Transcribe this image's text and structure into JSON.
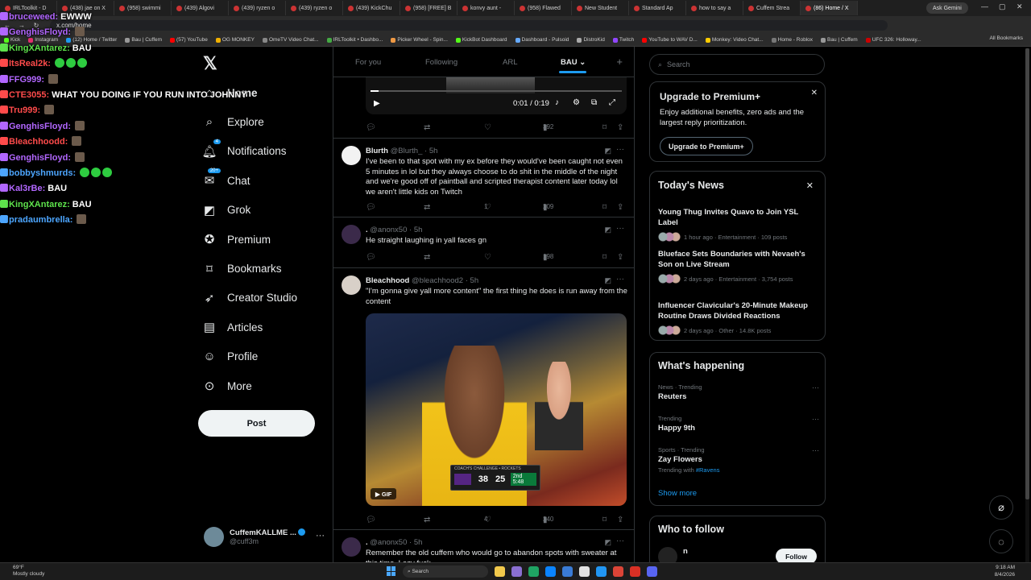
{
  "browser": {
    "tabs": [
      {
        "label": "IRLToolkit - D",
        "active": false
      },
      {
        "label": "(438) jae on X",
        "active": false
      },
      {
        "label": "(958) swimmi",
        "active": false
      },
      {
        "label": "(439) Algovi",
        "active": false
      },
      {
        "label": "(439) ryzen o",
        "active": false
      },
      {
        "label": "(439) ryzen o",
        "active": false
      },
      {
        "label": "(439) KickChu",
        "active": false
      },
      {
        "label": "(958) [FREE] B",
        "active": false
      },
      {
        "label": "konvy aunt -",
        "active": false
      },
      {
        "label": "(958) Flawed",
        "active": false
      },
      {
        "label": "New Student",
        "active": false
      },
      {
        "label": "Standard Ap",
        "active": false
      },
      {
        "label": "how to say a",
        "active": false
      },
      {
        "label": "Cuffem Strea",
        "active": false
      },
      {
        "label": "(86) Home / X",
        "active": true
      }
    ],
    "ask_gemini": "Ask Gemini",
    "url": "x.com/home",
    "bookmarks": [
      "Kick",
      "Instagram",
      "(12) Home / Twitter",
      "Bau | Cuffem",
      "(57) YouTube",
      "OG MONKEY",
      "OmeTV Video Chat...",
      "IRLToolkit • Dashbo...",
      "Picker Wheel - Spin...",
      "KickBot Dashboard",
      "Dashboard - Pulsoid",
      "DistroKid",
      "Twitch",
      "YouTube to WAV D...",
      "Monkey: Video Chat...",
      "Home - Roblox",
      "Bau | Cuffem",
      "UFC 326: Holloway..."
    ],
    "all_bookmarks": "All Bookmarks"
  },
  "chat": [
    {
      "user": "bruceweed:",
      "msg": "EWWW",
      "color": "#b267ff",
      "emotes": 0
    },
    {
      "user": "GenghisFloyd:",
      "msg": "",
      "color": "#b267ff",
      "emotes": 0
    },
    {
      "user": "KingXAntarez:",
      "msg": "BAU",
      "color": "#5ee34c",
      "emotes": 0
    },
    {
      "user": "ItsReal2k:",
      "msg": "",
      "color": "#ff4b4b",
      "emotes": 3
    },
    {
      "user": "FFG999:",
      "msg": "",
      "color": "#b267ff",
      "emotes": 0
    },
    {
      "user": "CTE3055:",
      "msg": "WHAT YOU DOING IF YOU RUN INTO JOHNNY",
      "color": "#ff4b4b",
      "emotes": 0
    },
    {
      "user": "Tru999:",
      "msg": "",
      "color": "#ff4b4b",
      "emotes": 0
    },
    {
      "user": "GenghisFloyd:",
      "msg": "",
      "color": "#b267ff",
      "emotes": 0
    },
    {
      "user": "Bleachhoodd:",
      "msg": "",
      "color": "#ff4b4b",
      "emotes": 0
    },
    {
      "user": "GenghisFloyd:",
      "msg": "",
      "color": "#b267ff",
      "emotes": 0
    },
    {
      "user": "bobbyshmurds:",
      "msg": "",
      "color": "#4da6ff",
      "emotes": 3
    },
    {
      "user": "Kal3rBe:",
      "msg": "BAU",
      "color": "#b267ff",
      "emotes": 0
    },
    {
      "user": "KingXAntarez:",
      "msg": "BAU",
      "color": "#5ee34c",
      "emotes": 0
    },
    {
      "user": "pradaumbrella:",
      "msg": "",
      "color": "#4da6ff",
      "emotes": 0
    }
  ],
  "nav": {
    "items": [
      {
        "label": "Home",
        "icon": "home-icon"
      },
      {
        "label": "Explore",
        "icon": "search-icon"
      },
      {
        "label": "Notifications",
        "icon": "bell-icon",
        "badge": "4"
      },
      {
        "label": "Chat",
        "icon": "chat-icon",
        "badge": "20+"
      },
      {
        "label": "Grok",
        "icon": "grok-icon"
      },
      {
        "label": "Premium",
        "icon": "premium-icon"
      },
      {
        "label": "Bookmarks",
        "icon": "bookmark-icon"
      },
      {
        "label": "Creator Studio",
        "icon": "rocket-icon"
      },
      {
        "label": "Articles",
        "icon": "article-icon"
      },
      {
        "label": "Profile",
        "icon": "person-icon"
      },
      {
        "label": "More",
        "icon": "more-circle-icon"
      }
    ],
    "post_label": "Post"
  },
  "account": {
    "name": "CuffemKALLME ...",
    "handle": "@cuff3m"
  },
  "feed": {
    "tabs": [
      "For you",
      "Following",
      "ARL",
      "BAU"
    ],
    "active_tab": "BAU",
    "video_time": "0:01 / 0:19",
    "first_views": "392",
    "tweets": [
      {
        "name": "Blurth",
        "handle": "@Blurth_",
        "time": "5h",
        "text": "I've been to that spot with my ex before they would've been caught not even 5 minutes in lol but they always choose to do shit in the middle of the night and we're good off of paintball and scripted therapist content later today lol we aren't little kids on Twitch",
        "likes": "1",
        "views": "209"
      },
      {
        "name": ".",
        "handle": "@anonx50",
        "time": "5h",
        "text": "He straight laughing in yall faces gn",
        "likes": "",
        "views": "198"
      },
      {
        "name": "Bleachhood",
        "handle": "@bleachhood2",
        "time": "5h",
        "text": "\"I'm gonna give yall more content\" the first thing he does is run away from the content",
        "likes": "4",
        "views": "240",
        "gif_label": "GIF",
        "scoreboard": {
          "header": "COACH'S CHALLENGE • ROCKETS",
          "home": "38",
          "away": "25",
          "clock": "2nd 5:48"
        }
      },
      {
        "name": ".",
        "handle": "@anonx50",
        "time": "5h",
        "text": "Remember the old cuffem who would go to abandon spots with sweater at this time. Lazy fuck"
      }
    ]
  },
  "right": {
    "search_placeholder": "Search",
    "premium": {
      "title": "Upgrade to Premium+",
      "desc": "Enjoy additional benefits, zero ads and the largest reply prioritization.",
      "button": "Upgrade to Premium+"
    },
    "news": {
      "title": "Today's News",
      "items": [
        {
          "headline": "Young Thug Invites Quavo to Join YSL Label",
          "meta": "1 hour ago · Entertainment · 109 posts"
        },
        {
          "headline": "Blueface Sets Boundaries with Nevaeh's Son on Live Stream",
          "meta": "2 days ago · Entertainment · 3,754 posts"
        },
        {
          "headline": "Influencer Clavicular's 20-Minute Makeup Routine Draws Divided Reactions",
          "meta": "2 days ago · Other · 14.8K posts"
        }
      ]
    },
    "happening": {
      "title": "What's happening",
      "trends": [
        {
          "context": "News · Trending",
          "name": "Reuters",
          "with": "",
          "with_tag": ""
        },
        {
          "context": "Trending",
          "name": "Happy 9th",
          "with": "",
          "with_tag": ""
        },
        {
          "context": "Sports · Trending",
          "name": "Zay Flowers",
          "with": "Trending with",
          "with_tag": "#Ravens"
        }
      ],
      "show_more": "Show more"
    },
    "follow": {
      "title": "Who to follow",
      "name": "n",
      "button": "Follow"
    }
  },
  "taskbar": {
    "weather_temp": "69°F",
    "weather_desc": "Mostly cloudy",
    "search": "Search",
    "time": "9:18 AM",
    "date": "8/4/2026"
  }
}
